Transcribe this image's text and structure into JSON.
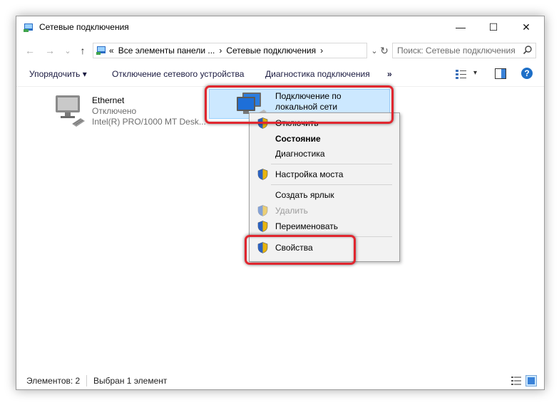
{
  "window": {
    "title": "Сетевые подключения",
    "controls": {
      "minimize": "—",
      "maximize": "☐",
      "close": "✕"
    }
  },
  "address_bar": {
    "back": "←",
    "forward": "→",
    "recent": "⌄",
    "up": "↑",
    "prefix": "«",
    "crumbs": [
      "Все элементы панели ...",
      "›",
      "Сетевые подключения",
      "›"
    ],
    "dropdown": "⌄",
    "refresh": "↻",
    "search_placeholder": "Поиск: Сетевые подключения"
  },
  "toolbar": {
    "organize": "Упорядочить ▾",
    "disable_device": "Отключение сетевого устройства",
    "diagnose": "Диагностика подключения",
    "more": "»",
    "view_dropdown": "▾",
    "help": "?"
  },
  "items": [
    {
      "name": "Ethernet",
      "status": "Отключено",
      "adapter": "Intel(R) PRO/1000 MT Desk..."
    },
    {
      "name_line1": "Подключение по",
      "name_line2": "локальной сети"
    }
  ],
  "context_menu": {
    "items": [
      {
        "label": "Отключить",
        "shield": true
      },
      {
        "label": "Состояние",
        "bold": true
      },
      {
        "label": "Диагностика"
      },
      {
        "label": "Настройка моста",
        "shield": true
      },
      {
        "label": "Создать ярлык"
      },
      {
        "label": "Удалить",
        "shield": true,
        "disabled": true
      },
      {
        "label": "Переименовать",
        "shield": true
      },
      {
        "label": "Свойства",
        "shield": true
      }
    ]
  },
  "status_bar": {
    "count": "Элементов: 2",
    "selected": "Выбран 1 элемент"
  },
  "colors": {
    "selection": "#cce8ff",
    "highlight": "#e0262f",
    "help": "#1e6fc7",
    "link": "#1a1a40"
  }
}
